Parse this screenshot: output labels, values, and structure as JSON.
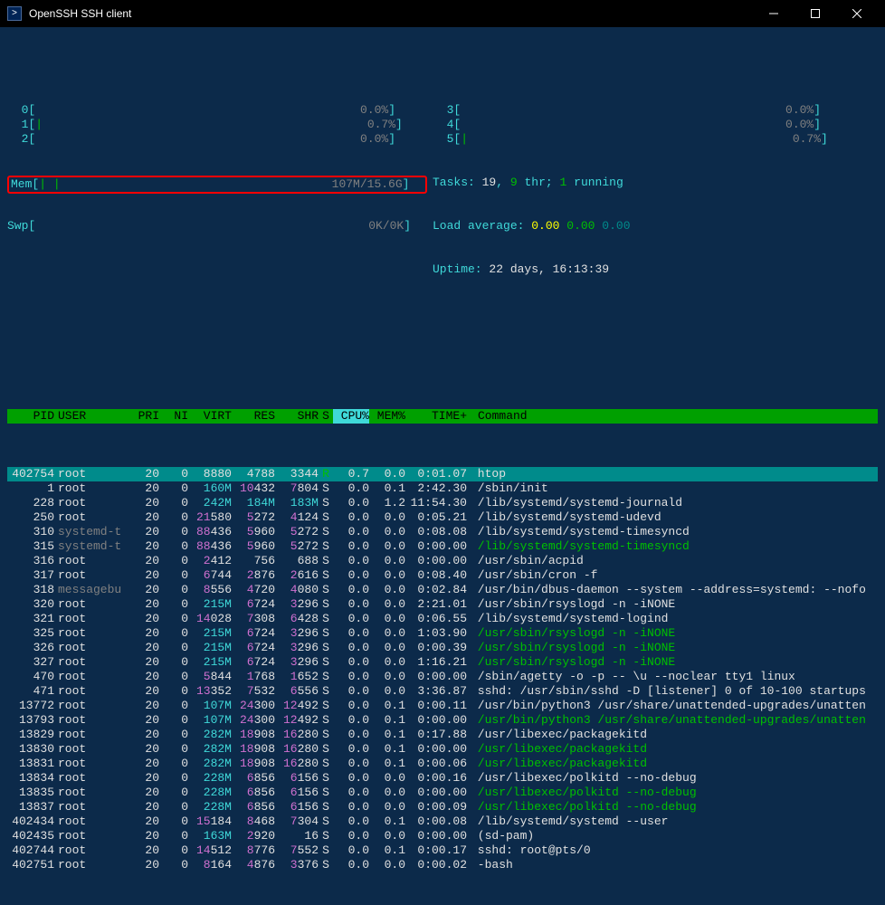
{
  "window": {
    "title": "OpenSSH SSH client"
  },
  "meters": {
    "cpu": [
      {
        "n": "0",
        "val": "0.0%"
      },
      {
        "n": "1",
        "val": "0.7%"
      },
      {
        "n": "2",
        "val": "0.0%"
      },
      {
        "n": "3",
        "val": "0.0%"
      },
      {
        "n": "4",
        "val": "0.0%"
      },
      {
        "n": "5",
        "val": "0.7%"
      }
    ],
    "mem_label": "Mem",
    "mem_val": "107M/15.6G",
    "swp_label": "Swp",
    "swp_val": "0K/0K",
    "tasks_label": "Tasks:",
    "tasks_total": "19",
    "tasks_thr": "9",
    "tasks_thr_label": "thr;",
    "tasks_running": "1",
    "tasks_running_label": "running",
    "load_label": "Load average:",
    "load1": "0.00",
    "load2": "0.00",
    "load3": "0.00",
    "uptime_label": "Uptime:",
    "uptime_val": "22 days, 16:13:39"
  },
  "headers": {
    "pid": "PID",
    "user": "USER",
    "pri": "PRI",
    "ni": "NI",
    "virt": "VIRT",
    "res": "RES",
    "shr": "SHR",
    "s": "S",
    "cpu": "CPU%",
    "mem": "MEM%",
    "time": "TIME+",
    "cmd": "Command"
  },
  "procs": [
    {
      "pid": "402754",
      "user": "root",
      "ucolor": "white",
      "pri": "20",
      "ni": "0",
      "virt": "8880",
      "res": "4788",
      "shr": "3344",
      "s": "R",
      "scolor": "green",
      "cpu": "0.7",
      "mem": "0.0",
      "time": "0:01.07",
      "cmd": "htop",
      "ccolor": "white",
      "sel": true
    },
    {
      "pid": "1",
      "user": "root",
      "ucolor": "white",
      "pri": "20",
      "ni": "0",
      "virt": "160M",
      "vcolor": "v-green",
      "res": "10432",
      "rcolor": "v-mag",
      "shr": "7804",
      "hcolor": "v-mag",
      "s": "S",
      "cpu": "0.0",
      "mem": "0.1",
      "time": "2:42.30",
      "cmd": "/sbin/init",
      "ccolor": "white"
    },
    {
      "pid": "228",
      "user": "root",
      "ucolor": "white",
      "pri": "20",
      "ni": "0",
      "virt": "242M",
      "vcolor": "v-green",
      "res": "184M",
      "rcolor": "v-green",
      "shr": "183M",
      "hcolor": "v-green",
      "s": "S",
      "cpu": "0.0",
      "mem": "1.2",
      "time": "11:54.30",
      "cmd": "/lib/systemd/systemd-journald",
      "ccolor": "white"
    },
    {
      "pid": "250",
      "user": "root",
      "ucolor": "white",
      "pri": "20",
      "ni": "0",
      "virt": "21580",
      "vcolor": "v-mag",
      "res": "5272",
      "rcolor": "v-mag",
      "shr": "4124",
      "hcolor": "v-mag",
      "s": "S",
      "cpu": "0.0",
      "mem": "0.0",
      "time": "0:05.21",
      "cmd": "/lib/systemd/systemd-udevd",
      "ccolor": "white"
    },
    {
      "pid": "310",
      "user": "systemd-t",
      "ucolor": "gray",
      "pri": "20",
      "ni": "0",
      "virt": "88436",
      "vcolor": "v-mag",
      "res": "5960",
      "rcolor": "v-mag",
      "shr": "5272",
      "hcolor": "v-mag",
      "s": "S",
      "cpu": "0.0",
      "mem": "0.0",
      "time": "0:08.08",
      "cmd": "/lib/systemd/systemd-timesyncd",
      "ccolor": "white"
    },
    {
      "pid": "315",
      "user": "systemd-t",
      "ucolor": "gray",
      "pri": "20",
      "ni": "0",
      "virt": "88436",
      "vcolor": "v-mag",
      "res": "5960",
      "rcolor": "v-mag",
      "shr": "5272",
      "hcolor": "v-mag",
      "s": "S",
      "cpu": "0.0",
      "mem": "0.0",
      "time": "0:00.00",
      "cmd": "/lib/systemd/systemd-timesyncd",
      "ccolor": "green"
    },
    {
      "pid": "316",
      "user": "root",
      "ucolor": "white",
      "pri": "20",
      "ni": "0",
      "virt": "2412",
      "vcolor": "v-mag",
      "res": "756",
      "shr": "688",
      "s": "S",
      "cpu": "0.0",
      "mem": "0.0",
      "time": "0:00.00",
      "cmd": "/usr/sbin/acpid",
      "ccolor": "white"
    },
    {
      "pid": "317",
      "user": "root",
      "ucolor": "white",
      "pri": "20",
      "ni": "0",
      "virt": "6744",
      "vcolor": "v-mag",
      "res": "2876",
      "rcolor": "v-mag",
      "shr": "2616",
      "hcolor": "v-mag",
      "s": "S",
      "cpu": "0.0",
      "mem": "0.0",
      "time": "0:08.40",
      "cmd": "/usr/sbin/cron -f",
      "ccolor": "white"
    },
    {
      "pid": "318",
      "user": "messagebu",
      "ucolor": "gray",
      "pri": "20",
      "ni": "0",
      "virt": "8556",
      "vcolor": "v-mag",
      "res": "4720",
      "rcolor": "v-mag",
      "shr": "4080",
      "hcolor": "v-mag",
      "s": "S",
      "cpu": "0.0",
      "mem": "0.0",
      "time": "0:02.84",
      "cmd": "/usr/bin/dbus-daemon --system --address=systemd: --nofo",
      "ccolor": "white"
    },
    {
      "pid": "320",
      "user": "root",
      "ucolor": "white",
      "pri": "20",
      "ni": "0",
      "virt": "215M",
      "vcolor": "v-green",
      "res": "6724",
      "rcolor": "v-mag",
      "shr": "3296",
      "hcolor": "v-mag",
      "s": "S",
      "cpu": "0.0",
      "mem": "0.0",
      "time": "2:21.01",
      "cmd": "/usr/sbin/rsyslogd -n -iNONE",
      "ccolor": "white"
    },
    {
      "pid": "321",
      "user": "root",
      "ucolor": "white",
      "pri": "20",
      "ni": "0",
      "virt": "14028",
      "vcolor": "v-mag",
      "res": "7308",
      "rcolor": "v-mag",
      "shr": "6428",
      "hcolor": "v-mag",
      "s": "S",
      "cpu": "0.0",
      "mem": "0.0",
      "time": "0:06.55",
      "cmd": "/lib/systemd/systemd-logind",
      "ccolor": "white"
    },
    {
      "pid": "325",
      "user": "root",
      "ucolor": "white",
      "pri": "20",
      "ni": "0",
      "virt": "215M",
      "vcolor": "v-green",
      "res": "6724",
      "rcolor": "v-mag",
      "shr": "3296",
      "hcolor": "v-mag",
      "s": "S",
      "cpu": "0.0",
      "mem": "0.0",
      "time": "1:03.90",
      "cmd": "/usr/sbin/rsyslogd -n -iNONE",
      "ccolor": "green"
    },
    {
      "pid": "326",
      "user": "root",
      "ucolor": "white",
      "pri": "20",
      "ni": "0",
      "virt": "215M",
      "vcolor": "v-green",
      "res": "6724",
      "rcolor": "v-mag",
      "shr": "3296",
      "hcolor": "v-mag",
      "s": "S",
      "cpu": "0.0",
      "mem": "0.0",
      "time": "0:00.39",
      "cmd": "/usr/sbin/rsyslogd -n -iNONE",
      "ccolor": "green"
    },
    {
      "pid": "327",
      "user": "root",
      "ucolor": "white",
      "pri": "20",
      "ni": "0",
      "virt": "215M",
      "vcolor": "v-green",
      "res": "6724",
      "rcolor": "v-mag",
      "shr": "3296",
      "hcolor": "v-mag",
      "s": "S",
      "cpu": "0.0",
      "mem": "0.0",
      "time": "1:16.21",
      "cmd": "/usr/sbin/rsyslogd -n -iNONE",
      "ccolor": "green"
    },
    {
      "pid": "470",
      "user": "root",
      "ucolor": "white",
      "pri": "20",
      "ni": "0",
      "virt": "5844",
      "vcolor": "v-mag",
      "res": "1768",
      "rcolor": "v-mag",
      "shr": "1652",
      "hcolor": "v-mag",
      "s": "S",
      "cpu": "0.0",
      "mem": "0.0",
      "time": "0:00.00",
      "cmd": "/sbin/agetty -o -p -- \\u --noclear tty1 linux",
      "ccolor": "white"
    },
    {
      "pid": "471",
      "user": "root",
      "ucolor": "white",
      "pri": "20",
      "ni": "0",
      "virt": "13352",
      "vcolor": "v-mag",
      "res": "7532",
      "rcolor": "v-mag",
      "shr": "6556",
      "hcolor": "v-mag",
      "s": "S",
      "cpu": "0.0",
      "mem": "0.0",
      "time": "3:36.87",
      "cmd": "sshd: /usr/sbin/sshd -D [listener] 0 of 10-100 startups",
      "ccolor": "white"
    },
    {
      "pid": "13772",
      "user": "root",
      "ucolor": "white",
      "pri": "20",
      "ni": "0",
      "virt": "107M",
      "vcolor": "v-green",
      "res": "24300",
      "rcolor": "v-mag",
      "shr": "12492",
      "hcolor": "v-mag",
      "s": "S",
      "cpu": "0.0",
      "mem": "0.1",
      "time": "0:00.11",
      "cmd": "/usr/bin/python3 /usr/share/unattended-upgrades/unatten",
      "ccolor": "white"
    },
    {
      "pid": "13793",
      "user": "root",
      "ucolor": "white",
      "pri": "20",
      "ni": "0",
      "virt": "107M",
      "vcolor": "v-green",
      "res": "24300",
      "rcolor": "v-mag",
      "shr": "12492",
      "hcolor": "v-mag",
      "s": "S",
      "cpu": "0.0",
      "mem": "0.1",
      "time": "0:00.00",
      "cmd": "/usr/bin/python3 /usr/share/unattended-upgrades/unatten",
      "ccolor": "green"
    },
    {
      "pid": "13829",
      "user": "root",
      "ucolor": "white",
      "pri": "20",
      "ni": "0",
      "virt": "282M",
      "vcolor": "v-green",
      "res": "18908",
      "rcolor": "v-mag",
      "shr": "16280",
      "hcolor": "v-mag",
      "s": "S",
      "cpu": "0.0",
      "mem": "0.1",
      "time": "0:17.88",
      "cmd": "/usr/libexec/packagekitd",
      "ccolor": "white"
    },
    {
      "pid": "13830",
      "user": "root",
      "ucolor": "white",
      "pri": "20",
      "ni": "0",
      "virt": "282M",
      "vcolor": "v-green",
      "res": "18908",
      "rcolor": "v-mag",
      "shr": "16280",
      "hcolor": "v-mag",
      "s": "S",
      "cpu": "0.0",
      "mem": "0.1",
      "time": "0:00.00",
      "cmd": "/usr/libexec/packagekitd",
      "ccolor": "green"
    },
    {
      "pid": "13831",
      "user": "root",
      "ucolor": "white",
      "pri": "20",
      "ni": "0",
      "virt": "282M",
      "vcolor": "v-green",
      "res": "18908",
      "rcolor": "v-mag",
      "shr": "16280",
      "hcolor": "v-mag",
      "s": "S",
      "cpu": "0.0",
      "mem": "0.1",
      "time": "0:00.06",
      "cmd": "/usr/libexec/packagekitd",
      "ccolor": "green"
    },
    {
      "pid": "13834",
      "user": "root",
      "ucolor": "white",
      "pri": "20",
      "ni": "0",
      "virt": "228M",
      "vcolor": "v-green",
      "res": "6856",
      "rcolor": "v-mag",
      "shr": "6156",
      "hcolor": "v-mag",
      "s": "S",
      "cpu": "0.0",
      "mem": "0.0",
      "time": "0:00.16",
      "cmd": "/usr/libexec/polkitd --no-debug",
      "ccolor": "white"
    },
    {
      "pid": "13835",
      "user": "root",
      "ucolor": "white",
      "pri": "20",
      "ni": "0",
      "virt": "228M",
      "vcolor": "v-green",
      "res": "6856",
      "rcolor": "v-mag",
      "shr": "6156",
      "hcolor": "v-mag",
      "s": "S",
      "cpu": "0.0",
      "mem": "0.0",
      "time": "0:00.00",
      "cmd": "/usr/libexec/polkitd --no-debug",
      "ccolor": "green"
    },
    {
      "pid": "13837",
      "user": "root",
      "ucolor": "white",
      "pri": "20",
      "ni": "0",
      "virt": "228M",
      "vcolor": "v-green",
      "res": "6856",
      "rcolor": "v-mag",
      "shr": "6156",
      "hcolor": "v-mag",
      "s": "S",
      "cpu": "0.0",
      "mem": "0.0",
      "time": "0:00.09",
      "cmd": "/usr/libexec/polkitd --no-debug",
      "ccolor": "green"
    },
    {
      "pid": "402434",
      "user": "root",
      "ucolor": "white",
      "pri": "20",
      "ni": "0",
      "virt": "15184",
      "vcolor": "v-mag",
      "res": "8468",
      "rcolor": "v-mag",
      "shr": "7304",
      "hcolor": "v-mag",
      "s": "S",
      "cpu": "0.0",
      "mem": "0.1",
      "time": "0:00.08",
      "cmd": "/lib/systemd/systemd --user",
      "ccolor": "white"
    },
    {
      "pid": "402435",
      "user": "root",
      "ucolor": "white",
      "pri": "20",
      "ni": "0",
      "virt": "163M",
      "vcolor": "v-green",
      "res": "2920",
      "rcolor": "v-mag",
      "shr": "16",
      "s": "S",
      "cpu": "0.0",
      "mem": "0.0",
      "time": "0:00.00",
      "cmd": "(sd-pam)",
      "ccolor": "white"
    },
    {
      "pid": "402744",
      "user": "root",
      "ucolor": "white",
      "pri": "20",
      "ni": "0",
      "virt": "14512",
      "vcolor": "v-mag",
      "res": "8776",
      "rcolor": "v-mag",
      "shr": "7552",
      "hcolor": "v-mag",
      "s": "S",
      "cpu": "0.0",
      "mem": "0.1",
      "time": "0:00.17",
      "cmd": "sshd: root@pts/0",
      "ccolor": "white"
    },
    {
      "pid": "402751",
      "user": "root",
      "ucolor": "white",
      "pri": "20",
      "ni": "0",
      "virt": "8164",
      "vcolor": "v-mag",
      "res": "4876",
      "rcolor": "v-mag",
      "shr": "3376",
      "hcolor": "v-mag",
      "s": "S",
      "cpu": "0.0",
      "mem": "0.0",
      "time": "0:00.02",
      "cmd": "-bash",
      "ccolor": "white"
    }
  ]
}
